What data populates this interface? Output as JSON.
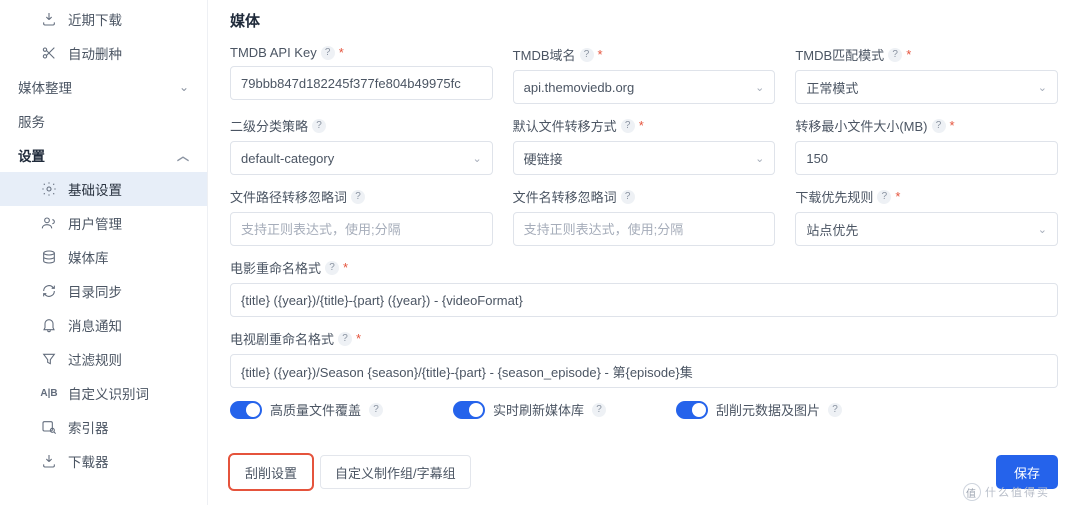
{
  "sidebar": {
    "top": [
      {
        "label": "近期下载"
      },
      {
        "label": "自动删种"
      }
    ],
    "group_media": "媒体整理",
    "group_service": "服务",
    "group_settings": "设置",
    "settings": [
      {
        "label": "基础设置"
      },
      {
        "label": "用户管理"
      },
      {
        "label": "媒体库"
      },
      {
        "label": "目录同步"
      },
      {
        "label": "消息通知"
      },
      {
        "label": "过滤规则"
      },
      {
        "label": "自定义识别词"
      },
      {
        "label": "索引器"
      },
      {
        "label": "下载器"
      }
    ]
  },
  "main": {
    "title": "媒体",
    "fields": {
      "apikey": {
        "label": "TMDB API Key",
        "value": "79bbb847d182245f377fe804b49975fc"
      },
      "domain": {
        "label": "TMDB域名",
        "value": "api.themoviedb.org"
      },
      "matchmode": {
        "label": "TMDB匹配模式",
        "value": "正常模式"
      },
      "l2cat": {
        "label": "二级分类策略",
        "value": "default-category"
      },
      "defmove": {
        "label": "默认文件转移方式",
        "value": "硬链接"
      },
      "minsize": {
        "label": "转移最小文件大小(MB)",
        "value": "150"
      },
      "pathignore": {
        "label": "文件路径转移忽略词",
        "placeholder": "支持正则表达式，使用;分隔"
      },
      "nameignore": {
        "label": "文件名转移忽略词",
        "placeholder": "支持正则表达式，使用;分隔"
      },
      "dlpriority": {
        "label": "下载优先规则",
        "value": "站点优先"
      },
      "moviefmt": {
        "label": "电影重命名格式",
        "value": "{title} ({year})/{title}-{part} ({year}) - {videoFormat}"
      },
      "tvfmt": {
        "label": "电视剧重命名格式",
        "value": "{title} ({year})/Season {season}/{title}-{part} - {season_episode} - 第{episode}集"
      }
    },
    "toggles": {
      "hq": "高质量文件覆盖",
      "refresh": "实时刷新媒体库",
      "scrape": "刮削元数据及图片"
    },
    "tabs": {
      "scrape": "刮削设置",
      "custom": "自定义制作组/字幕组"
    },
    "save": "保存",
    "watermark": "什么值得买"
  }
}
